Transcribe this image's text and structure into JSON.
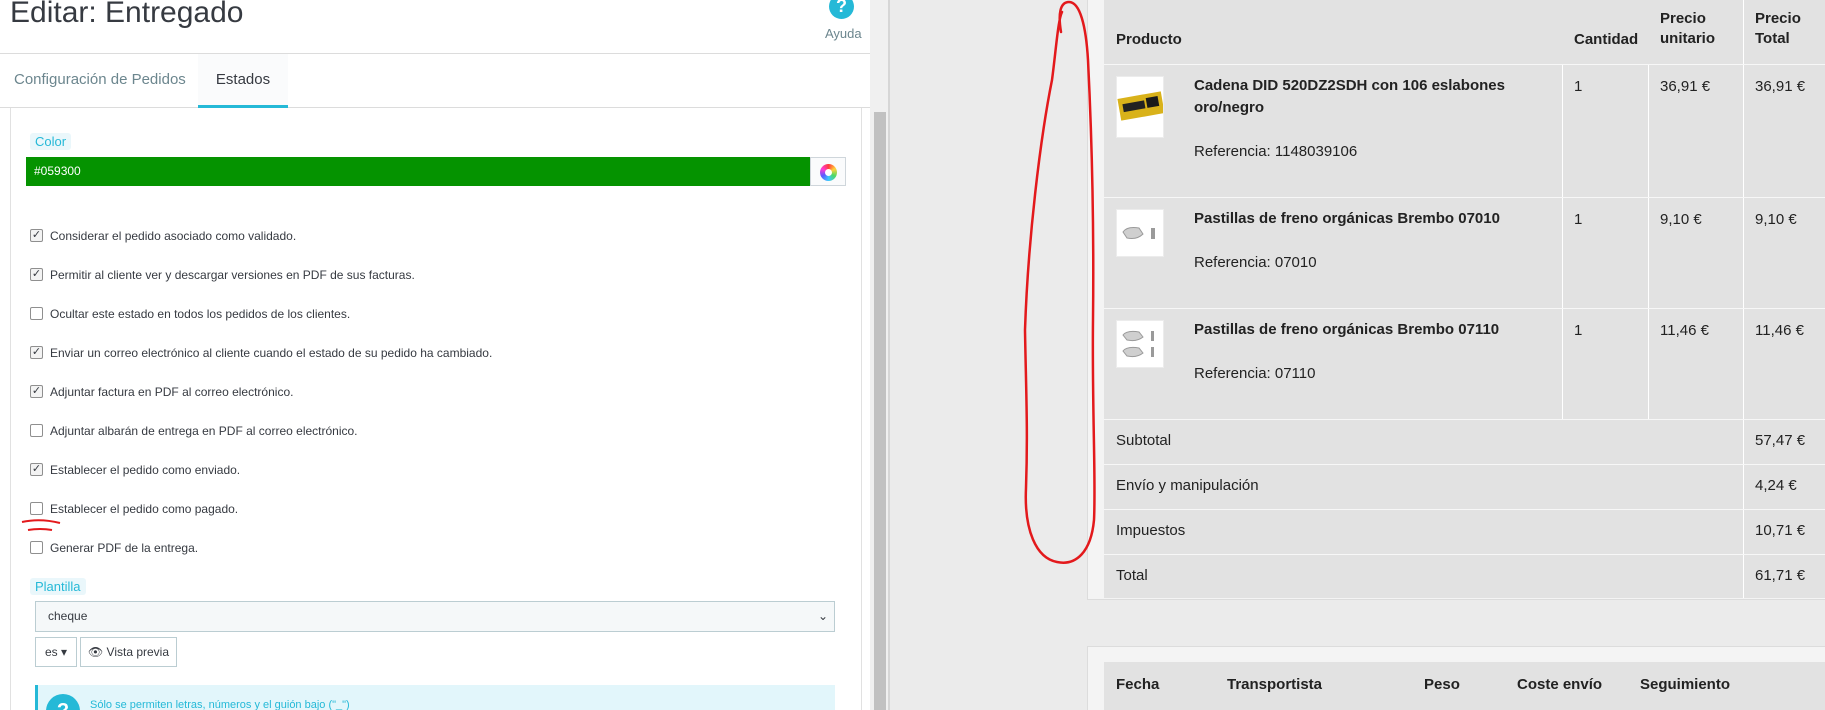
{
  "header": {
    "title": "Editar: Entregado",
    "help_label": "Ayuda",
    "help_glyph": "?"
  },
  "tabs": [
    {
      "label": "Configuración de Pedidos",
      "active": false
    },
    {
      "label": "Estados",
      "active": true
    }
  ],
  "color_field": {
    "label": "Color",
    "value": "#059300",
    "accent": "#059300"
  },
  "options": [
    {
      "label": "Considerar el pedido asociado como validado.",
      "checked": true
    },
    {
      "label": "Permitir al cliente ver y descargar versiones en PDF de sus facturas.",
      "checked": true
    },
    {
      "label": "Ocultar este estado en todos los pedidos de los clientes.",
      "checked": false
    },
    {
      "label": "Enviar un correo electrónico al cliente cuando el estado de su pedido ha cambiado.",
      "checked": true
    },
    {
      "label": "Adjuntar factura en PDF al correo electrónico.",
      "checked": true
    },
    {
      "label": "Adjuntar albarán de entrega en PDF al correo electrónico.",
      "checked": false
    },
    {
      "label": "Establecer el pedido como enviado.",
      "checked": true
    },
    {
      "label": "Establecer el pedido como pagado.",
      "checked": false
    },
    {
      "label": "Generar PDF de la entrega.",
      "checked": false
    }
  ],
  "template_field": {
    "label": "Plantilla",
    "selected": "cheque",
    "lang": "es ▾",
    "preview_label": "👁 Vista previa"
  },
  "info": {
    "icon": "?",
    "text": "Sólo se permiten letras, números y el guión bajo (\"_\")"
  },
  "order_table": {
    "headers": {
      "product": "Producto",
      "quantity": "Cantidad",
      "unit_price": "Precio unitario",
      "total_price": "Precio Total"
    },
    "rows": [
      {
        "name": "Cadena DID 520DZ2SDH con 106 eslabones oro/negro",
        "reference": "Referencia: 1148039106",
        "quantity": "1",
        "unit_price": "36,91 €",
        "total": "36,91 €"
      },
      {
        "name": "Pastillas de freno orgánicas Brembo 07010",
        "reference": "Referencia: 07010",
        "quantity": "1",
        "unit_price": "9,10 €",
        "total": "9,10 €"
      },
      {
        "name": "Pastillas de freno orgánicas Brembo 07110",
        "reference": "Referencia: 07110",
        "quantity": "1",
        "unit_price": "11,46 €",
        "total": "11,46 €"
      }
    ],
    "summary": [
      {
        "label": "Subtotal",
        "value": "57,47 €"
      },
      {
        "label": "Envío y manipulación",
        "value": "4,24 €"
      },
      {
        "label": "Impuestos",
        "value": "10,71 €"
      },
      {
        "label": "Total",
        "value": "61,71 €"
      }
    ]
  },
  "shipping_table": {
    "headers": [
      "Fecha",
      "Transportista",
      "Peso",
      "Coste envío",
      "Seguimiento"
    ]
  },
  "colors": {
    "accent": "#25b9d7",
    "annotation": "#e3191c",
    "table_bg": "#e2e2e2"
  }
}
